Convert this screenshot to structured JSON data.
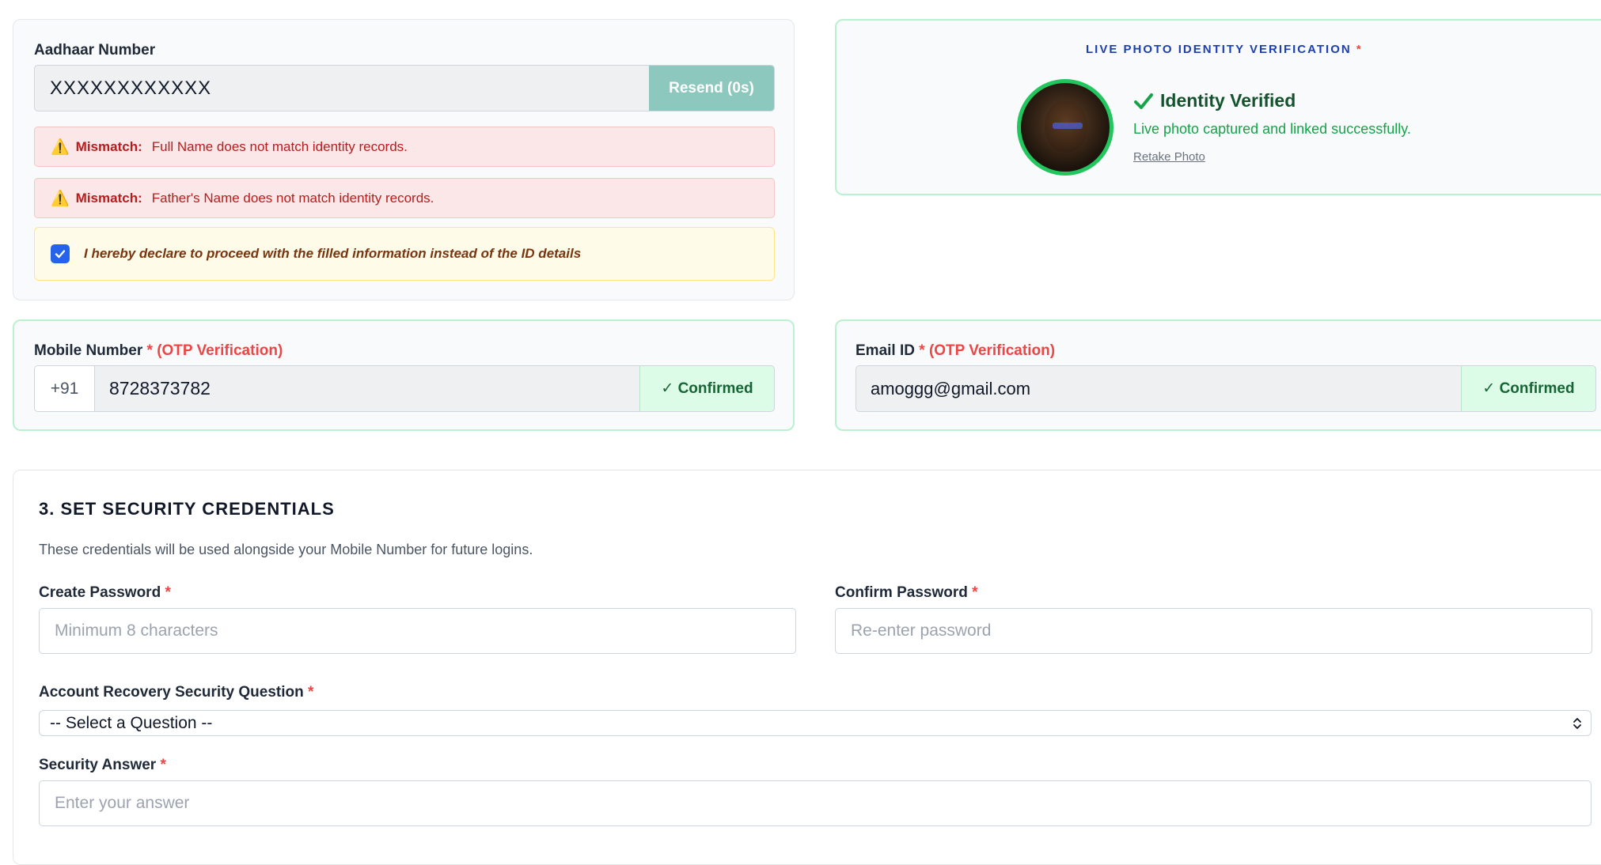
{
  "aadhaar": {
    "label": "Aadhaar Number",
    "value": "XXXXXXXXXXXX",
    "resend_label": "Resend (0s)",
    "mismatches": [
      {
        "prefix": "Mismatch:",
        "message": "Full Name does not match identity records."
      },
      {
        "prefix": "Mismatch:",
        "message": "Father's Name does not match identity records."
      }
    ],
    "declaration": "I hereby declare to proceed with the filled information instead of the ID details",
    "declaration_checked": true
  },
  "live_photo": {
    "title": "LIVE PHOTO IDENTITY VERIFICATION",
    "required_mark": "*",
    "status_title": "Identity Verified",
    "status_message": "Live photo captured and linked successfully.",
    "retake_label": "Retake Photo"
  },
  "mobile": {
    "label": "Mobile Number",
    "required_mark": "*",
    "otp_note": "(OTP Verification)",
    "country_code": "+91",
    "value": "8728373782",
    "status_label": "✓ Confirmed"
  },
  "email": {
    "label": "Email ID",
    "required_mark": "*",
    "otp_note": "(OTP Verification)",
    "value": "amoggg@gmail.com",
    "status_label": "✓ Confirmed"
  },
  "security": {
    "heading": "3. SET SECURITY CREDENTIALS",
    "description": "These credentials will be used alongside your Mobile Number for future logins.",
    "create_password_label": "Create Password",
    "create_password_placeholder": "Minimum 8 characters",
    "confirm_password_label": "Confirm Password",
    "confirm_password_placeholder": "Re-enter password",
    "question_label": "Account Recovery Security Question",
    "question_selected": "-- Select a Question --",
    "answer_label": "Security Answer",
    "answer_placeholder": "Enter your answer",
    "required_mark": "*"
  },
  "colors": {
    "accent_green": "#22c55e",
    "alert_red": "#b91c1c",
    "heading_blue": "#1e40af",
    "checkbox_blue": "#2563eb"
  }
}
